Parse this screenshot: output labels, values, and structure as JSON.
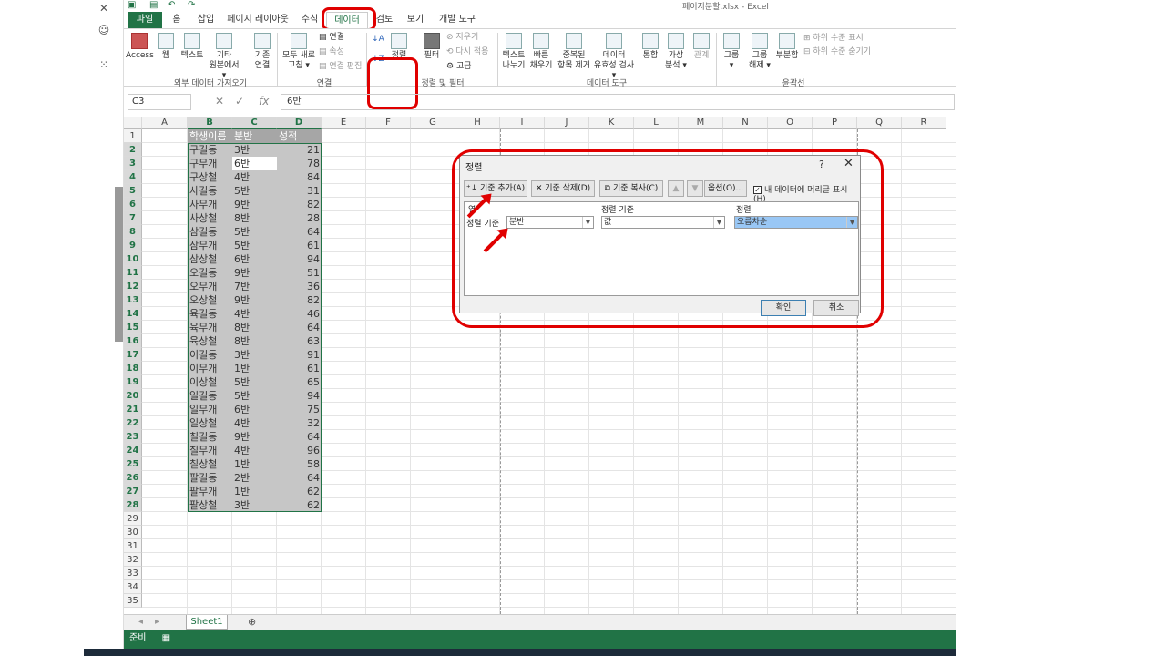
{
  "window_title": "페이지분할.xlsx - Excel",
  "ribbon_tabs": [
    "파일",
    "홈",
    "삽입",
    "페이지 레이아웃",
    "수식",
    "데이터",
    "검토",
    "보기",
    "개발 도구"
  ],
  "active_tab": "데이터",
  "ribbon": {
    "external_data": {
      "access": "Access",
      "web": "웹",
      "text": "텍스트",
      "other_line1": "기타",
      "other_line2": "원본에서 ▾",
      "existing_line1": "기존",
      "existing_line2": "연결",
      "group": "외부 데이터 가져오기"
    },
    "connections": {
      "refresh_line1": "모두 새로",
      "refresh_line2": "고침 ▾",
      "conn": "연결",
      "props": "속성",
      "edit_links": "연결 편집",
      "group": "연결"
    },
    "sort_filter": {
      "sort": "정렬",
      "filter": "필터",
      "clear": "지우기",
      "reapply": "다시 적용",
      "advanced": "고급",
      "group": "정렬 및 필터"
    },
    "data_tools": {
      "ttc_line1": "텍스트",
      "ttc_line2": "나누기",
      "flash_line1": "빠른",
      "flash_line2": "채우기",
      "dup_line1": "중복된",
      "dup_line2": "항목 제거",
      "valid_line1": "데이터",
      "valid_line2": "유효성 검사 ▾",
      "consolidate": "통합",
      "whatif_line1": "가상",
      "whatif_line2": "분석 ▾",
      "relations": "관계",
      "group": "데이터 도구"
    },
    "outline": {
      "group_line1": "그룹",
      "group_line2": "▾",
      "ungroup_line1": "그룹",
      "ungroup_line2": "해제 ▾",
      "subtotal": "부분합",
      "show": "하위 수준 표시",
      "hide": "하위 수준 숨기기",
      "group": "윤곽선"
    }
  },
  "formula_bar": {
    "name_box": "C3",
    "fx": "fx",
    "value": "6반"
  },
  "columns": [
    "A",
    "B",
    "C",
    "D",
    "E",
    "F",
    "G",
    "H",
    "I",
    "J",
    "K",
    "L",
    "M",
    "N",
    "O",
    "P",
    "Q",
    "R"
  ],
  "rows": [
    "1",
    "2",
    "3",
    "4",
    "5",
    "6",
    "7",
    "8",
    "9",
    "10",
    "11",
    "12",
    "13",
    "14",
    "15",
    "16",
    "17",
    "18",
    "19",
    "20",
    "21",
    "22",
    "23",
    "24",
    "25",
    "26",
    "27",
    "28",
    "29",
    "30",
    "31",
    "32",
    "33",
    "34",
    "35"
  ],
  "table": {
    "headers": [
      "학생이름",
      "분반",
      "성적"
    ],
    "data": [
      [
        "구길동",
        "3반",
        "21"
      ],
      [
        "구무개",
        "6반",
        "78"
      ],
      [
        "구상철",
        "4반",
        "84"
      ],
      [
        "사길동",
        "5반",
        "31"
      ],
      [
        "사무개",
        "9반",
        "82"
      ],
      [
        "사상철",
        "8반",
        "28"
      ],
      [
        "삼길동",
        "5반",
        "64"
      ],
      [
        "삼무개",
        "5반",
        "61"
      ],
      [
        "삼상철",
        "6반",
        "94"
      ],
      [
        "오길동",
        "9반",
        "51"
      ],
      [
        "오무개",
        "7반",
        "36"
      ],
      [
        "오상철",
        "9반",
        "82"
      ],
      [
        "육길동",
        "4반",
        "46"
      ],
      [
        "육무개",
        "8반",
        "64"
      ],
      [
        "육상철",
        "8반",
        "63"
      ],
      [
        "이길동",
        "3반",
        "91"
      ],
      [
        "이무개",
        "1반",
        "61"
      ],
      [
        "이상철",
        "5반",
        "65"
      ],
      [
        "일길동",
        "5반",
        "94"
      ],
      [
        "일무개",
        "6반",
        "75"
      ],
      [
        "일상철",
        "4반",
        "32"
      ],
      [
        "칠길동",
        "9반",
        "64"
      ],
      [
        "칠무개",
        "4반",
        "96"
      ],
      [
        "칠상철",
        "1반",
        "58"
      ],
      [
        "팔길동",
        "2반",
        "64"
      ],
      [
        "팔무개",
        "1반",
        "62"
      ],
      [
        "팔상철",
        "3반",
        "62"
      ]
    ]
  },
  "sheet_tab": "Sheet1",
  "status": "준비",
  "dialog": {
    "title": "정렬",
    "help": "?",
    "close": "✕",
    "add_level": "기준 추가(A)",
    "delete_level": "기준 삭제(D)",
    "copy_level": "기준 복사(C)",
    "options": "옵션(O)...",
    "header_check": "내 데이터에 머리글 표시(H)",
    "col_header": "열",
    "sort_on_header": "정렬 기준",
    "order_header": "정렬",
    "row_label": "정렬 기준",
    "column_value": "분반",
    "sort_on_value": "값",
    "order_value": "오름차순",
    "ok": "확인",
    "cancel": "취소"
  }
}
